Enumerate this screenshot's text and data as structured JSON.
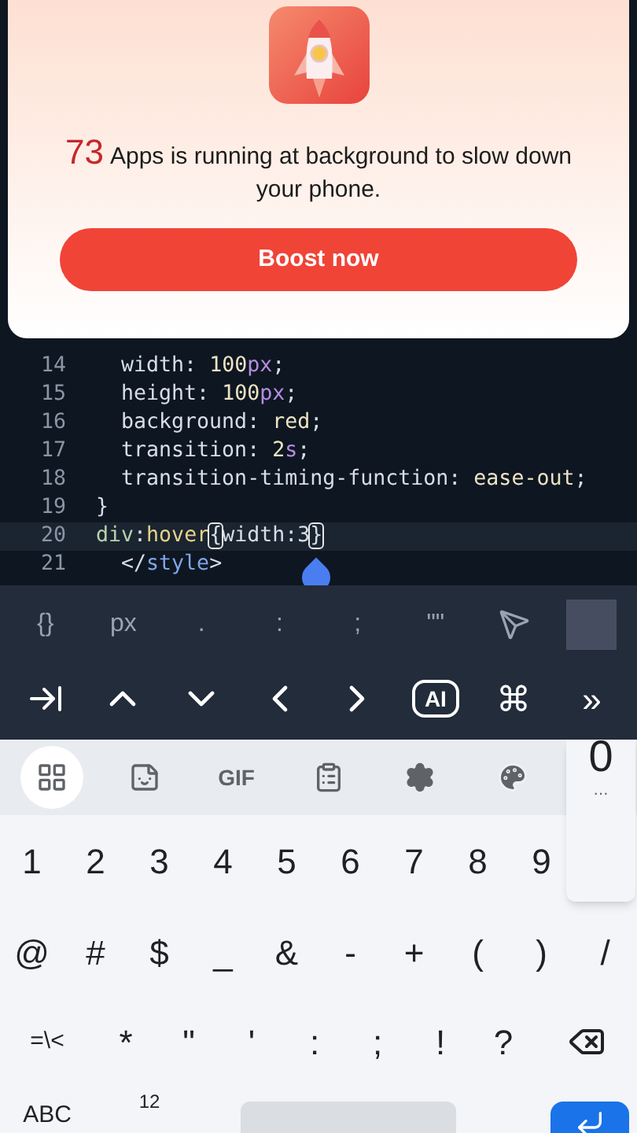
{
  "popup": {
    "count": "73",
    "message": "Apps is running at background to slow down your phone.",
    "button": "Boost now"
  },
  "editor": {
    "lines": [
      {
        "number": "14",
        "current": false,
        "segments": [
          {
            "text": "  width: ",
            "kind": "plain"
          },
          {
            "text": "100",
            "kind": "number"
          },
          {
            "text": "px",
            "kind": "unit"
          },
          {
            "text": ";",
            "kind": "plain"
          }
        ]
      },
      {
        "number": "15",
        "current": false,
        "segments": [
          {
            "text": "  height: ",
            "kind": "plain"
          },
          {
            "text": "100",
            "kind": "number"
          },
          {
            "text": "px",
            "kind": "unit"
          },
          {
            "text": ";",
            "kind": "plain"
          }
        ]
      },
      {
        "number": "16",
        "current": false,
        "segments": [
          {
            "text": "  background: ",
            "kind": "plain"
          },
          {
            "text": "red",
            "kind": "value"
          },
          {
            "text": ";",
            "kind": "plain"
          }
        ]
      },
      {
        "number": "17",
        "current": false,
        "segments": [
          {
            "text": "  transition: ",
            "kind": "plain"
          },
          {
            "text": "2",
            "kind": "number"
          },
          {
            "text": "s",
            "kind": "unit"
          },
          {
            "text": ";",
            "kind": "plain"
          }
        ]
      },
      {
        "number": "18",
        "current": false,
        "segments": [
          {
            "text": "  transition-timing-function: ",
            "kind": "plain"
          },
          {
            "text": "ease-out",
            "kind": "value"
          },
          {
            "text": ";",
            "kind": "plain"
          }
        ]
      },
      {
        "number": "19",
        "current": false,
        "segments": [
          {
            "text": "}",
            "kind": "plain"
          }
        ]
      },
      {
        "number": "20",
        "current": true,
        "segments": [
          {
            "text": "div",
            "kind": "selector"
          },
          {
            "text": ":",
            "kind": "plain"
          },
          {
            "text": "hover",
            "kind": "pseudo"
          },
          {
            "text": "{",
            "kind": "bracket"
          },
          {
            "text": "width:3",
            "kind": "plain"
          },
          {
            "text": "}",
            "kind": "bracket"
          }
        ]
      },
      {
        "number": "21",
        "current": false,
        "segments": [
          {
            "text": "  </",
            "kind": "plain"
          },
          {
            "text": "style",
            "kind": "tag"
          },
          {
            "text": ">",
            "kind": "plain"
          }
        ]
      }
    ]
  },
  "toolbar": {
    "row_1": [
      {
        "kind": "key",
        "label": "{}"
      },
      {
        "kind": "key",
        "label": "px"
      },
      {
        "kind": "key",
        "label": "."
      },
      {
        "kind": "key",
        "label": ":"
      },
      {
        "kind": "key",
        "label": ";"
      },
      {
        "kind": "key",
        "label": "\"\""
      },
      {
        "kind": "icon"
      },
      {
        "kind": "square"
      }
    ],
    "row_2": [
      {
        "kind": "icon"
      },
      {
        "kind": "icon"
      },
      {
        "kind": "icon"
      },
      {
        "kind": "icon"
      },
      {
        "kind": "icon"
      },
      {
        "kind": "boxed",
        "label": "AI"
      },
      {
        "kind": "key",
        "label": "⌘"
      },
      {
        "kind": "key",
        "label": "»"
      }
    ]
  },
  "keyboard": {
    "suggestion_bar": [
      {
        "kind": "icon",
        "selected": true
      },
      {
        "kind": "icon",
        "selected": false
      },
      {
        "kind": "text",
        "label": "GIF",
        "selected": false
      },
      {
        "kind": "icon",
        "selected": false
      },
      {
        "kind": "icon",
        "selected": false
      },
      {
        "kind": "icon",
        "selected": false
      }
    ],
    "number_row": [
      "1",
      "2",
      "3",
      "4",
      "5",
      "6",
      "7",
      "8",
      "9"
    ],
    "symbol_row": [
      "@",
      "#",
      "$",
      "_",
      "&",
      "-",
      "+",
      "(",
      ")",
      "/"
    ],
    "third_row": [
      "=\\<",
      "*",
      "\"",
      "'",
      ":",
      ";",
      "!",
      "?"
    ],
    "bottom_row": [
      "ABC",
      "12"
    ],
    "key_popup": {
      "key": "0",
      "more": "…"
    }
  }
}
